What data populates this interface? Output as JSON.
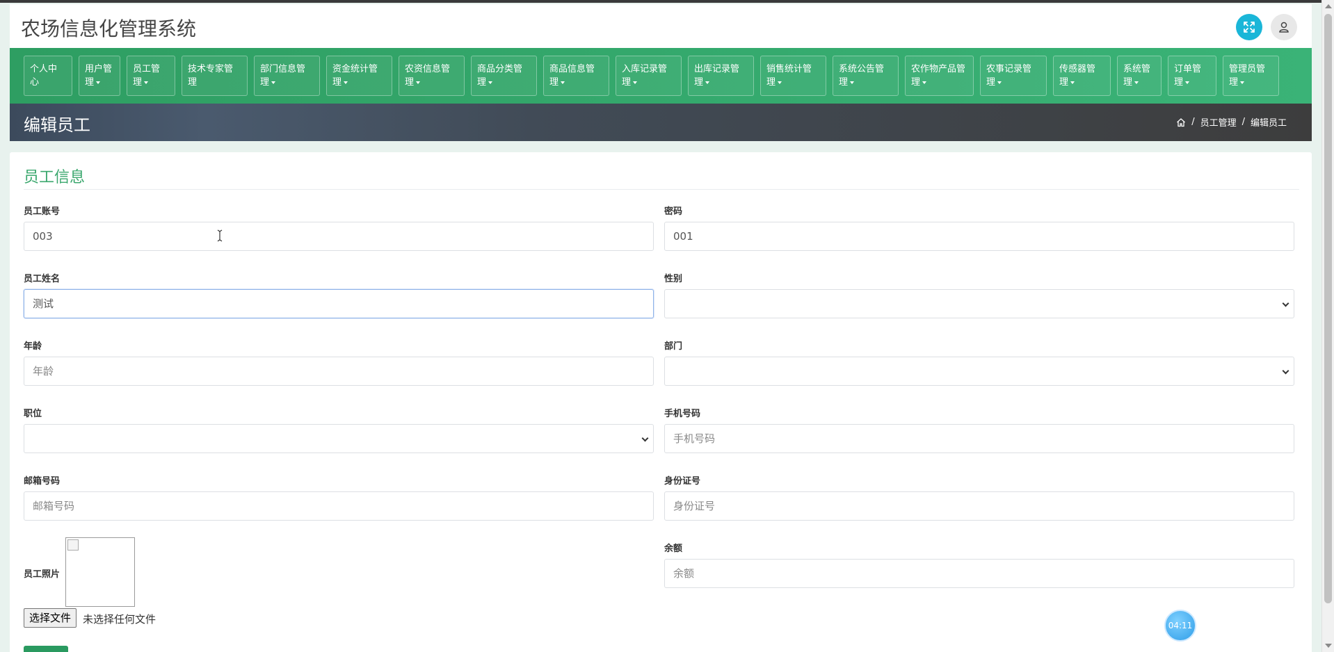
{
  "app": {
    "title": "农场信息化管理系统"
  },
  "nav": {
    "items": [
      {
        "line1": "个人中",
        "line2": "心",
        "caret": false
      },
      {
        "line1": "用户管",
        "line2": "理",
        "caret": true
      },
      {
        "line1": "员工管",
        "line2": "理",
        "caret": true
      },
      {
        "line1": "技术专家管",
        "line2": "理",
        "caret": false
      },
      {
        "line1": "部门信息管",
        "line2": "理",
        "caret": true
      },
      {
        "line1": "资金统计管",
        "line2": "理",
        "caret": true
      },
      {
        "line1": "农资信息管",
        "line2": "理",
        "caret": true
      },
      {
        "line1": "商品分类管",
        "line2": "理",
        "caret": true
      },
      {
        "line1": "商品信息管",
        "line2": "理",
        "caret": true
      },
      {
        "line1": "入库记录管",
        "line2": "理",
        "caret": true
      },
      {
        "line1": "出库记录管",
        "line2": "理",
        "caret": true
      },
      {
        "line1": "销售统计管",
        "line2": "理",
        "caret": true
      },
      {
        "line1": "系统公告管",
        "line2": "理",
        "caret": true
      },
      {
        "line1": "农作物产品管",
        "line2": "理",
        "caret": true
      },
      {
        "line1": "农事记录管",
        "line2": "理",
        "caret": true
      },
      {
        "line1": "传感器管",
        "line2": "理",
        "caret": true
      },
      {
        "line1": "系统管",
        "line2": "理",
        "caret": true
      },
      {
        "line1": "订单管",
        "line2": "理",
        "caret": true
      },
      {
        "line1": "管理员管",
        "line2": "理",
        "caret": true
      }
    ]
  },
  "page": {
    "title": "编辑员工",
    "breadcrumb": [
      "员工管理",
      "编辑员工"
    ]
  },
  "form": {
    "section_title": "员工信息",
    "fields": {
      "account": {
        "label": "员工账号",
        "value": "003"
      },
      "password": {
        "label": "密码",
        "value": "001"
      },
      "name": {
        "label": "员工姓名",
        "value": "测试"
      },
      "gender": {
        "label": "性别",
        "value": ""
      },
      "age": {
        "label": "年龄",
        "placeholder": "年龄"
      },
      "department": {
        "label": "部门",
        "value": ""
      },
      "position": {
        "label": "职位",
        "value": ""
      },
      "phone": {
        "label": "手机号码",
        "placeholder": "手机号码"
      },
      "email": {
        "label": "邮箱号码",
        "placeholder": "邮箱号码"
      },
      "id_card": {
        "label": "身份证号",
        "placeholder": "身份证号"
      },
      "photo": {
        "label": "员工照片"
      },
      "balance": {
        "label": "余额",
        "placeholder": "余额"
      }
    },
    "file": {
      "button": "选择文件",
      "status": "未选择任何文件"
    }
  },
  "timer": {
    "text": "04:11"
  },
  "colors": {
    "nav_green": "#2e9e62",
    "accent_green": "#3aa76d",
    "fullscreen_cyan": "#1ab6d8"
  }
}
